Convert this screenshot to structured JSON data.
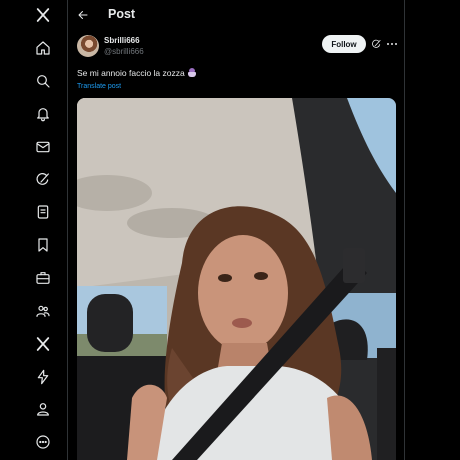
{
  "nav": {
    "items": [
      {
        "name": "x-logo-icon"
      },
      {
        "name": "home-icon"
      },
      {
        "name": "search-icon"
      },
      {
        "name": "notifications-icon"
      },
      {
        "name": "messages-icon"
      },
      {
        "name": "grok-icon"
      },
      {
        "name": "lists-icon"
      },
      {
        "name": "bookmarks-icon"
      },
      {
        "name": "jobs-icon"
      },
      {
        "name": "communities-icon"
      },
      {
        "name": "premium-icon"
      },
      {
        "name": "verified-orgs-icon"
      },
      {
        "name": "profile-icon"
      },
      {
        "name": "more-icon"
      }
    ]
  },
  "header": {
    "title": "Post"
  },
  "post": {
    "author": {
      "display_name": "Sbrilli666",
      "handle": "@sbrilli666"
    },
    "follow_label": "Follow",
    "text": "Se mi annoio faccio la zozza",
    "emoji": "genie-emoji",
    "translate_label": "Translate post",
    "media": {
      "type": "photo",
      "subject": "selfie-in-car"
    }
  },
  "colors": {
    "background": "#000000",
    "text": "#e7e9ea",
    "muted": "#71767b",
    "link": "#1d9bf0",
    "follow_bg": "#eff3f4",
    "border": "#2f3336"
  }
}
